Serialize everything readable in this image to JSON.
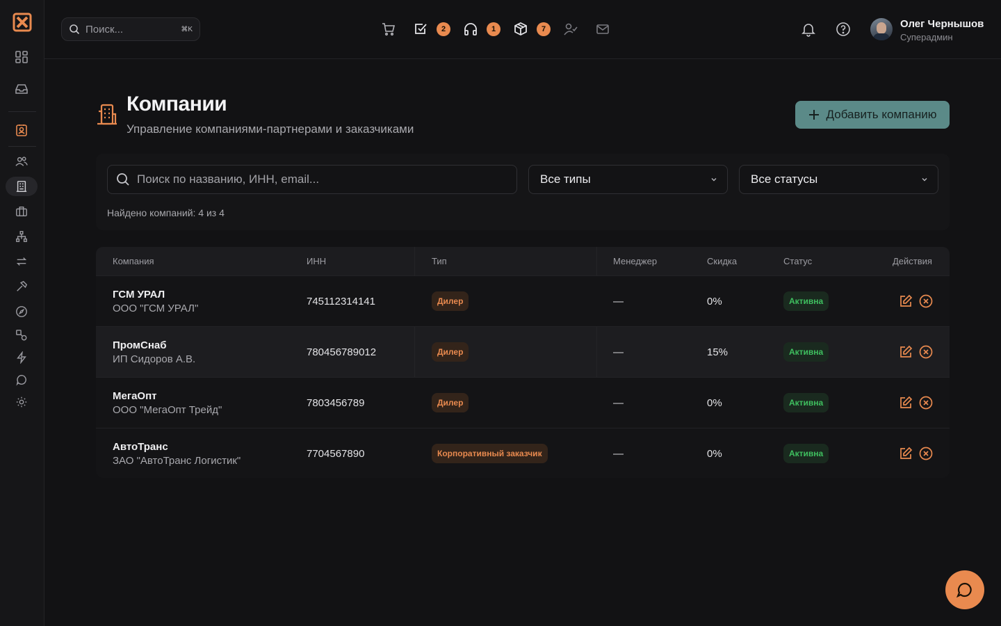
{
  "topbar": {
    "search_placeholder": "Поиск...",
    "search_shortcut": "⌘K",
    "quick_badges": {
      "tasks": "2",
      "support": "1",
      "packages": "7"
    },
    "user": {
      "name": "Олег Чернышов",
      "role": "Суперадмин"
    }
  },
  "page": {
    "title": "Компании",
    "subtitle": "Управление компаниями-партнерами и заказчиками",
    "add_button": "Добавить компанию"
  },
  "filters": {
    "search_placeholder": "Поиск по названию, ИНН, email...",
    "type_select": "Все типы",
    "status_select": "Все статусы",
    "found_text": "Найдено компаний: 4 из 4"
  },
  "table": {
    "headers": {
      "company": "Компания",
      "inn": "ИНН",
      "type": "Тип",
      "manager": "Менеджер",
      "discount": "Скидка",
      "status": "Статус",
      "actions": "Действия"
    },
    "rows": [
      {
        "name": "ГСМ УРАЛ",
        "legal": "ООО \"ГСМ УРАЛ\"",
        "inn": "745112314141",
        "type": "Дилер",
        "manager": "—",
        "discount": "0%",
        "status": "Активна"
      },
      {
        "name": "ПромСнаб",
        "legal": "ИП Сидоров А.В.",
        "inn": "780456789012",
        "type": "Дилер",
        "manager": "—",
        "discount": "15%",
        "status": "Активна"
      },
      {
        "name": "МегаОпт",
        "legal": "ООО \"МегаОпт Трейд\"",
        "inn": "7803456789",
        "type": "Дилер",
        "manager": "—",
        "discount": "0%",
        "status": "Активна"
      },
      {
        "name": "АвтоТранс",
        "legal": "ЗАО \"АвтоТранс Логистик\"",
        "inn": "7704567890",
        "type": "Корпоративный заказчик",
        "manager": "—",
        "discount": "0%",
        "status": "Активна"
      }
    ]
  },
  "colors": {
    "accent": "#e98a4f",
    "primary_button": "#5b8a88",
    "status_active": "#3fbf5f",
    "background": "#121214"
  }
}
